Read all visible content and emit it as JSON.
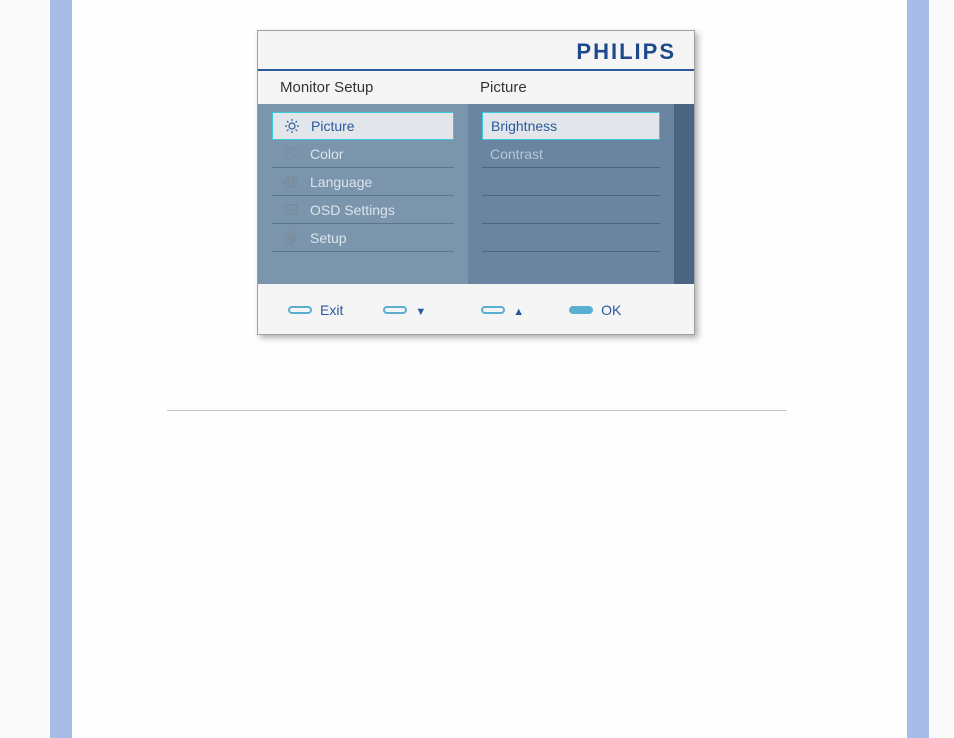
{
  "brand": "PHILIPS",
  "header": {
    "left_title": "Monitor Setup",
    "right_title": "Picture"
  },
  "main_menu": [
    {
      "label": "Picture",
      "icon": "sun",
      "selected": true
    },
    {
      "label": "Color",
      "icon": "palette",
      "selected": false
    },
    {
      "label": "Language",
      "icon": "globe",
      "selected": false
    },
    {
      "label": "OSD Settings",
      "icon": "screen",
      "selected": false
    },
    {
      "label": "Setup",
      "icon": "gear",
      "selected": false
    }
  ],
  "sub_menu": [
    {
      "label": "Brightness",
      "selected": true
    },
    {
      "label": "Contrast",
      "selected": false
    }
  ],
  "footer": {
    "exit_label": "Exit",
    "ok_label": "OK"
  }
}
